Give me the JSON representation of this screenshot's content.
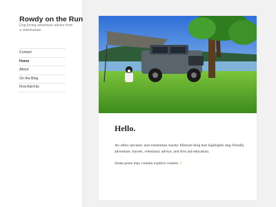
{
  "site": {
    "title": "Rowdy on the Run",
    "description": "Dog loving adventure advice from a veterinarian"
  },
  "nav": {
    "items": [
      {
        "label": "Contact",
        "current": false
      },
      {
        "label": "Home",
        "current": true
      },
      {
        "label": "About",
        "current": false
      },
      {
        "label": "On the Blog",
        "current": false
      },
      {
        "label": "First Aid Kits",
        "current": false
      }
    ]
  },
  "post": {
    "title": "Hello.",
    "paragraph1": "An often sarcastic and sometimes snarky lifestyle blog that highlights dog friendly adventure, travels, veterinary advice, and first aid education.",
    "paragraph2": "Some posts may contain explicit content",
    "paragraph2_emoji": "☺"
  },
  "colors": {
    "page_background": "#f1f1f1",
    "panel_background": "#ffffff"
  },
  "icons": {
    "emoji": "smiling-face-icon"
  }
}
